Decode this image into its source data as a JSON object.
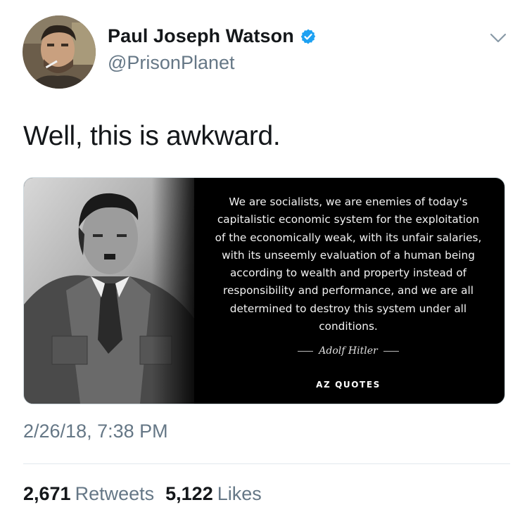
{
  "tweet": {
    "display_name": "Paul Joseph Watson",
    "handle": "@PrisonPlanet",
    "verified": true,
    "text": "Well, this is awkward.",
    "timestamp": "2/26/18, 7:38 PM"
  },
  "media": {
    "quote_text": "We are socialists, we are enemies of today's capitalistic economic system for the exploitation of the economically weak, with its unfair salaries, with its unseemly evaluation of a human being according to wealth and property instead of responsibility and performance, and we are all determined to destroy this system under all conditions.",
    "quote_author": "Adolf Hitler",
    "brand": "AZ QUOTES"
  },
  "stats": {
    "retweets_count": "2,671",
    "retweets_label": "Retweets",
    "likes_count": "5,122",
    "likes_label": "Likes"
  },
  "icons": {
    "verified": "verified-badge-icon",
    "menu": "chevron-down-icon"
  },
  "colors": {
    "verified_blue": "#1da1f2",
    "secondary_text": "#657786",
    "primary_text": "#14171a",
    "divider": "#e1e8ed"
  }
}
